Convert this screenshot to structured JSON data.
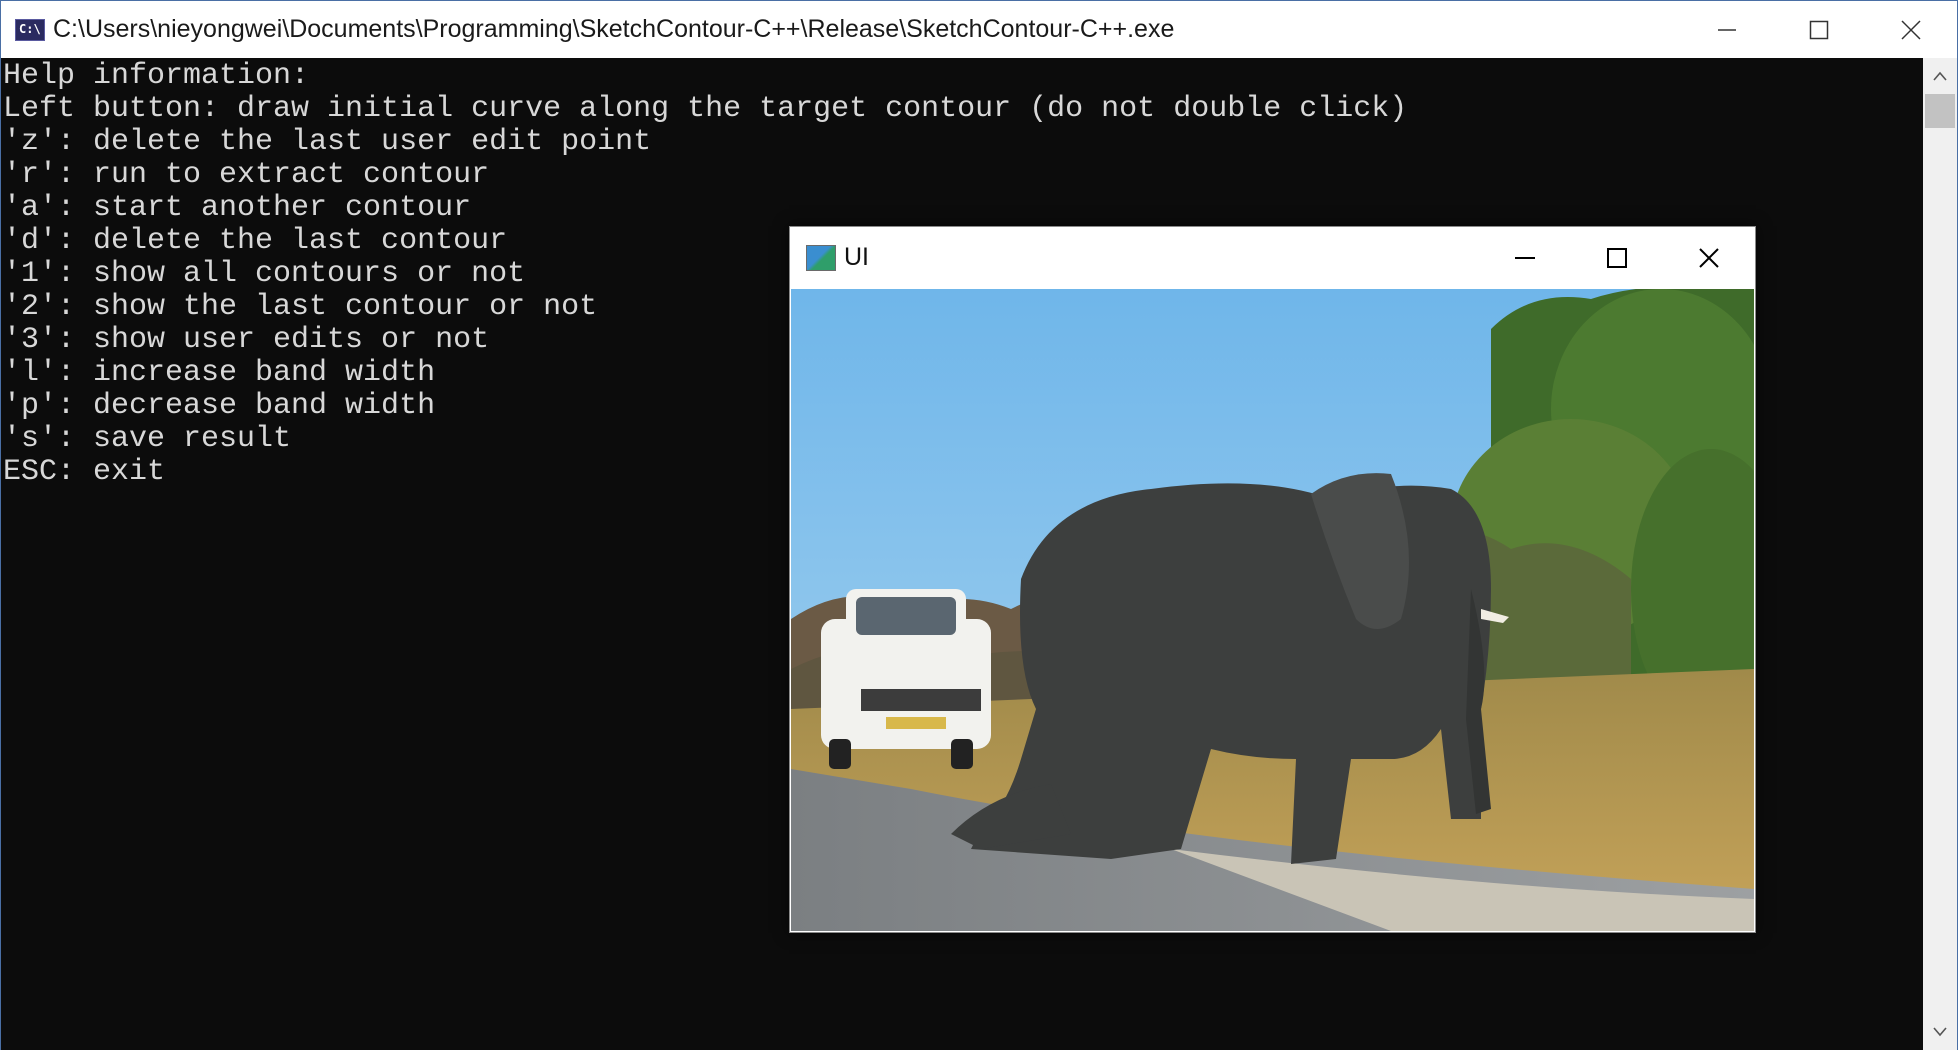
{
  "console": {
    "title": "C:\\Users\\nieyongwei\\Documents\\Programming\\SketchContour-C++\\Release\\SketchContour-C++.exe",
    "icon": "console-app-icon",
    "icon_text": "C:\\",
    "help_lines": [
      "Help information:",
      "Left button: draw initial curve along the target contour (do not double click)",
      "'z': delete the last user edit point",
      "'r': run to extract contour",
      "'a': start another contour",
      "'d': delete the last contour",
      "'1': show all contours or not",
      "'2': show the last contour or not",
      "'3': show user edits or not",
      "'l': increase band width",
      "'p': decrease band width",
      "'s': save result",
      "ESC: exit"
    ]
  },
  "ui_window": {
    "title": "UI",
    "icon": "image-window-icon",
    "image": {
      "subject": "elephant-crossing-road-photo"
    }
  },
  "colors": {
    "console_bg": "#0c0c0c",
    "console_text": "#d8d8d8",
    "titlebar_bg": "#ffffff"
  }
}
